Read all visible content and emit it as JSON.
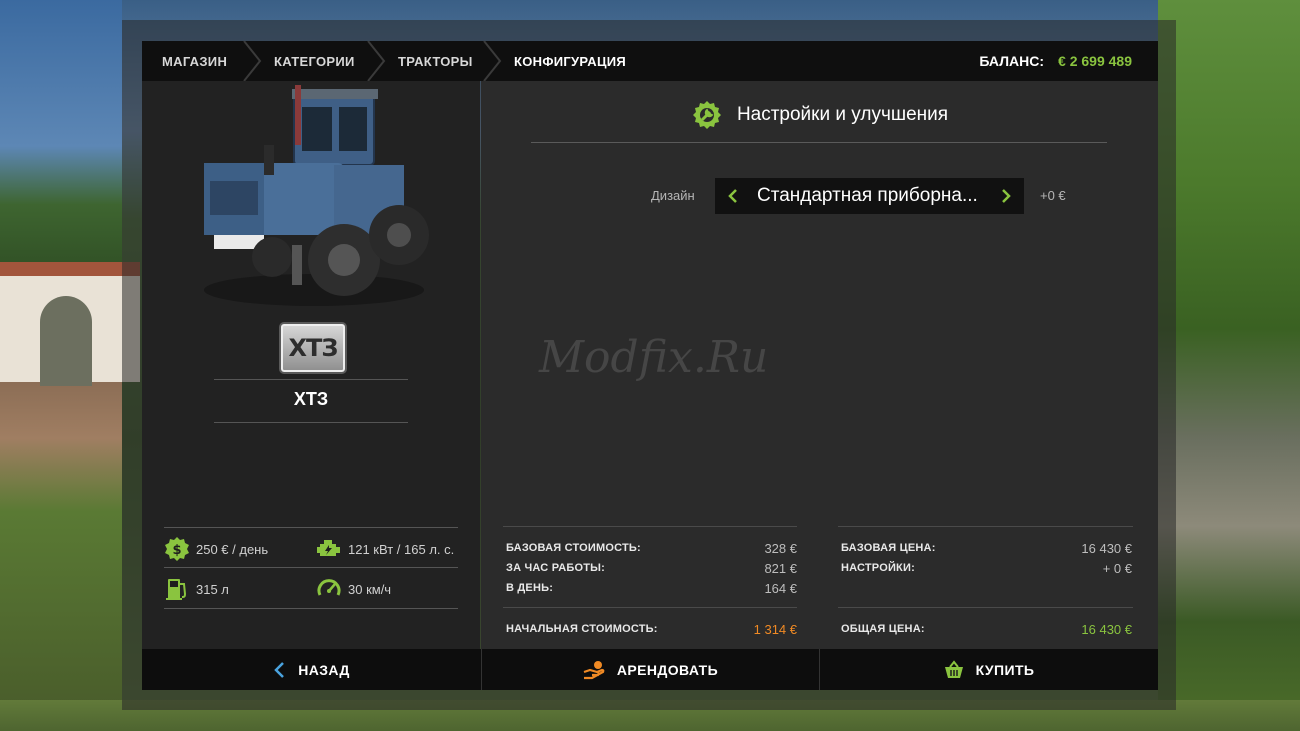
{
  "breadcrumbs": [
    "МАГАЗИН",
    "КАТЕГОРИИ",
    "ТРАКТОРЫ",
    "КОНФИГУРАЦИЯ"
  ],
  "balance": {
    "label": "БАЛАНС:",
    "value": "€ 2 699 489"
  },
  "vehicle": {
    "brand_logo_text": "ХТЗ",
    "name": "ХТЗ",
    "specs": {
      "rent_per_day": "250 € / день",
      "power": "121 кВт / 165 л. с.",
      "fuel": "315 л",
      "speed": "30 км/ч"
    }
  },
  "settings": {
    "title": "Настройки и улучшения",
    "config": {
      "label": "Дизайн",
      "value": "Стандартная приборна...",
      "price": "+0 €"
    }
  },
  "watermark": "Modfix.Ru",
  "costs": {
    "left": [
      {
        "label": "БАЗОВАЯ СТОИМОСТЬ:",
        "value": "328 €"
      },
      {
        "label": "ЗА ЧАС РАБОТЫ:",
        "value": "821 €"
      },
      {
        "label": "В ДЕНЬ:",
        "value": "164 €"
      }
    ],
    "left_total": {
      "label": "НАЧАЛЬНАЯ СТОИМОСТЬ:",
      "value": "1 314 €"
    },
    "right": [
      {
        "label": "БАЗОВАЯ ЦЕНА:",
        "value": "16 430 €"
      },
      {
        "label": "НАСТРОЙКИ:",
        "value": "+ 0 €"
      }
    ],
    "right_total": {
      "label": "ОБЩАЯ ЦЕНА:",
      "value": "16 430 €"
    }
  },
  "buttons": {
    "back": "НАЗАД",
    "rent": "АРЕНДОВАТЬ",
    "buy": "КУПИТЬ"
  },
  "colors": {
    "accent_green": "#8ac43f",
    "accent_orange": "#f08a24",
    "nav_bg": "#0f0f0f"
  }
}
